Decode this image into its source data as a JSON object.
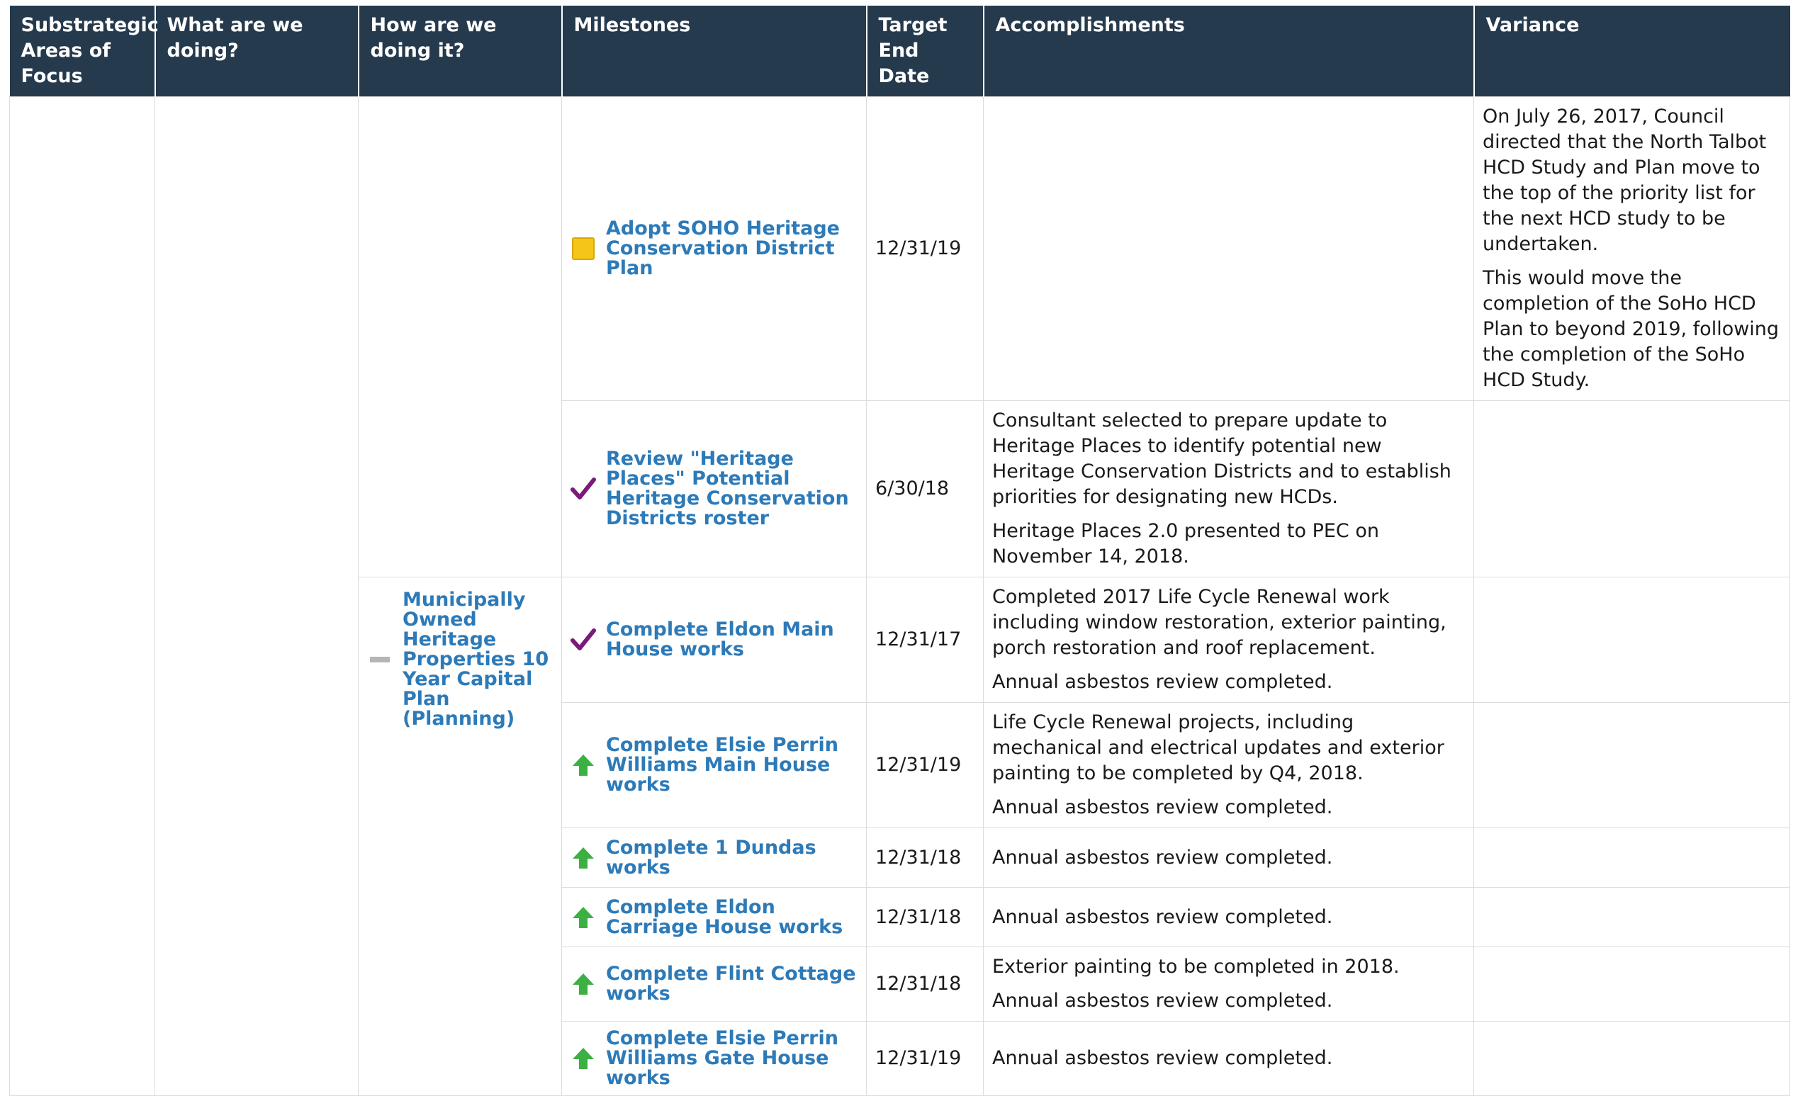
{
  "headers": {
    "col1": "Substrategic Areas of Focus",
    "col2": "What are we doing?",
    "col3": "How are we doing it?",
    "col4": "Milestones",
    "col5": "Target End Date",
    "col6": "Accomplishments",
    "col7": "Variance"
  },
  "program": {
    "title": "Municipally Owned Heritage Properties 10 Year Capital Plan (Planning)",
    "status_icon": "dash-icon"
  },
  "rows": [
    {
      "milestone": "Adopt SOHO Heritage Conservation District Plan",
      "status_icon": "yellow-square-icon",
      "date": "12/31/19",
      "accomplishments": [],
      "variance": [
        "On July 26, 2017, Council directed that the North Talbot HCD Study and Plan move to the top of the priority list for the next HCD study to be undertaken.",
        "This would move the completion of the SoHo HCD Plan to beyond 2019, following the completion of the SoHo HCD Study."
      ]
    },
    {
      "milestone": "Review \"Heritage Places\" Potential Heritage Conservation Districts roster",
      "status_icon": "checkmark-icon",
      "date": "6/30/18",
      "accomplishments": [
        "Consultant selected to prepare update to Heritage Places to identify potential new Heritage Conservation Districts and to establish priorities for designating new HCDs.",
        "Heritage Places 2.0 presented to PEC on November 14, 2018."
      ],
      "variance": []
    },
    {
      "milestone": "Complete Eldon Main House works",
      "status_icon": "checkmark-icon",
      "date": "12/31/17",
      "accomplishments": [
        "Completed 2017 Life Cycle Renewal work including window restoration, exterior painting, porch restoration and roof replacement.",
        "Annual asbestos review completed."
      ],
      "variance": []
    },
    {
      "milestone": "Complete Elsie Perrin Williams Main House works",
      "status_icon": "up-arrow-icon",
      "date": "12/31/19",
      "accomplishments": [
        "Life Cycle Renewal projects, including mechanical and electrical updates and exterior painting to be completed by Q4, 2018.",
        "Annual asbestos review completed."
      ],
      "variance": []
    },
    {
      "milestone": "Complete 1 Dundas works",
      "status_icon": "up-arrow-icon",
      "date": "12/31/18",
      "accomplishments": [
        "Annual asbestos review completed."
      ],
      "variance": []
    },
    {
      "milestone": "Complete Eldon Carriage House works",
      "status_icon": "up-arrow-icon",
      "date": "12/31/18",
      "accomplishments": [
        "Annual asbestos review completed."
      ],
      "variance": []
    },
    {
      "milestone": "Complete Flint Cottage works",
      "status_icon": "up-arrow-icon",
      "date": "12/31/18",
      "accomplishments": [
        "Exterior painting to be completed in 2018.",
        "Annual asbestos review completed."
      ],
      "variance": []
    },
    {
      "milestone": "Complete Elsie Perrin Williams Gate House works",
      "status_icon": "up-arrow-icon",
      "date": "12/31/19",
      "accomplishments": [
        "Annual asbestos review completed."
      ],
      "variance": []
    }
  ],
  "colors": {
    "header_bg": "#263a4d",
    "link": "#2d7ab8",
    "checkmark": "#7a1a7a",
    "arrow": "#3cb043",
    "yellow": "#f5c518"
  }
}
